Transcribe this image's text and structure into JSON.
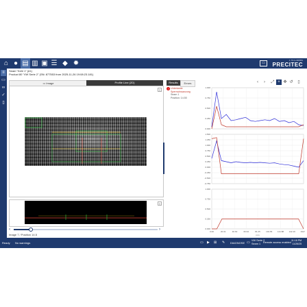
{
  "app": {
    "brand": "PRECITEC",
    "version": "1.76.0+43f8f69"
  },
  "toolbar": {
    "icons": [
      "home-icon",
      "user-icon",
      "folder-icon",
      "chart-icon",
      "window-icon",
      "table-icon",
      "tag-icon",
      "gear-icon"
    ]
  },
  "seam": {
    "title": "Seam \"Kehl 1\" (#1)",
    "product": "Product 80 \"VW Serie 2\" (SN: 877553 from 2025-11-26 19:08:23.181)"
  },
  "viewer": {
    "tabs": [
      "Image",
      "Profile Line (2D)"
    ],
    "image_position": "Image 7 / Position 14.5"
  },
  "results": {
    "tabs": [
      "Results",
      "Errors"
    ],
    "alarm_title": "Unterkante Sperrschwanzung",
    "alarm_sub1": "Seam 1",
    "alarm_sub2": "Position: 14.50"
  },
  "chart_data": [
    {
      "type": "line",
      "ylim": [
        0,
        1
      ],
      "yticks": [
        "1.000",
        "0.750",
        "0.500",
        "0.250",
        "0.000"
      ],
      "series": [
        {
          "color": "#2b2bd8",
          "values": [
            0.05,
            0.9,
            0.25,
            0.35,
            0.2,
            0.22,
            0.25,
            0.28,
            0.2,
            0.18,
            0.2,
            0.22,
            0.2,
            0.25,
            0.18,
            0.2,
            0.15,
            0.18,
            0.1,
            0.08
          ]
        },
        {
          "color": "#c0392b",
          "values": [
            0.0,
            0.55,
            0.1,
            0.05,
            0.05,
            0.05,
            0.05,
            0.05,
            0.05,
            0.05,
            0.05,
            0.05,
            0.05,
            0.05,
            0.05,
            0.05,
            0.05,
            0.05,
            0.05,
            0.1
          ]
        }
      ]
    },
    {
      "type": "line",
      "ylim": [
        -0.75,
        1.5
      ],
      "yticks": [
        "1.500",
        "1.250",
        "1.000",
        "0.750",
        "0.500",
        "0.250",
        "0.000",
        "-0.250",
        "-0.500",
        "-0.750"
      ],
      "series": [
        {
          "color": "#2b2bd8",
          "values": [
            0.4,
            1.2,
            0.3,
            0.25,
            0.2,
            0.25,
            0.22,
            0.2,
            0.22,
            0.2,
            0.22,
            0.2,
            0.18,
            0.2,
            0.15,
            0.12,
            0.1,
            0.05,
            0.0,
            0.3
          ]
        },
        {
          "color": "#c0392b",
          "values": [
            1.3,
            1.35,
            -0.3,
            -0.3,
            -0.3,
            -0.3,
            -0.3,
            -0.3,
            -0.3,
            -0.3,
            -0.3,
            -0.3,
            -0.3,
            -0.3,
            -0.3,
            -0.3,
            -0.3,
            -0.3,
            -0.3,
            1.3
          ]
        }
      ]
    },
    {
      "type": "line",
      "ylim": [
        0,
        1
      ],
      "yticks": [
        "1.000",
        "0.750",
        "0.500",
        "0.250",
        "0.000"
      ],
      "xticks": [
        "0.00",
        "20.31",
        "40.63",
        "60.94",
        "81.25",
        "101.56",
        "121.88",
        "142.19",
        "162.50"
      ],
      "xlabel": "mm",
      "series": [
        {
          "color": "#c0392b",
          "values": [
            0,
            0,
            0.25,
            0.25,
            0.25,
            0.25,
            0.25,
            0.25,
            0.25,
            0.25,
            0.25,
            0.25,
            0.25,
            0.25,
            0.25,
            0.25,
            0.25,
            0.25,
            0
          ]
        }
      ]
    }
  ],
  "status": {
    "left": "Ready",
    "warnings": "No warnings",
    "diagnose": "DIAGNOSE",
    "product": "VW Serie 2",
    "seam": "Seam 1",
    "remote": "Remote access enabled",
    "time": "11:18 PM",
    "date": "11/26/25"
  }
}
